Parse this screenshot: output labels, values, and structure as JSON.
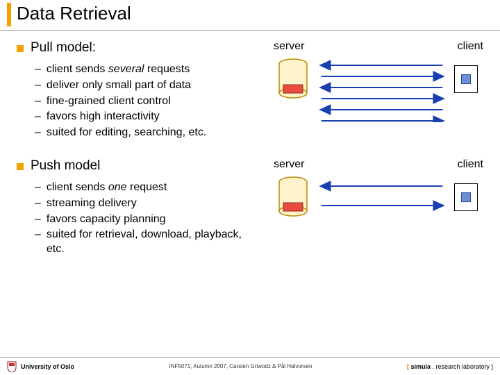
{
  "title": "Data Retrieval",
  "pull": {
    "heading": "Pull model:",
    "items": [
      {
        "pre": "client sends ",
        "em": "several",
        "post": " requests"
      },
      {
        "pre": "deliver only small part of data"
      },
      {
        "pre": "fine-grained client control"
      },
      {
        "pre": "favors high interactivity"
      },
      {
        "pre": "suited for editing, searching, etc."
      }
    ],
    "server_label": "server",
    "client_label": "client"
  },
  "push": {
    "heading": "Push model",
    "items": [
      {
        "pre": "client sends ",
        "em": "one",
        "post": " request"
      },
      {
        "pre": "streaming delivery"
      },
      {
        "pre": "favors capacity planning"
      },
      {
        "pre": "suited for retrieval, download, playback, etc."
      }
    ],
    "server_label": "server",
    "client_label": "client"
  },
  "footer": {
    "left": "University of Oslo",
    "center": "INF5071, Autumn 2007, Carsten Griwodz & Pål Halvorsen",
    "right_bracket_open": "[ ",
    "right_simula": "simula",
    "right_rest": " . research laboratory ]"
  }
}
